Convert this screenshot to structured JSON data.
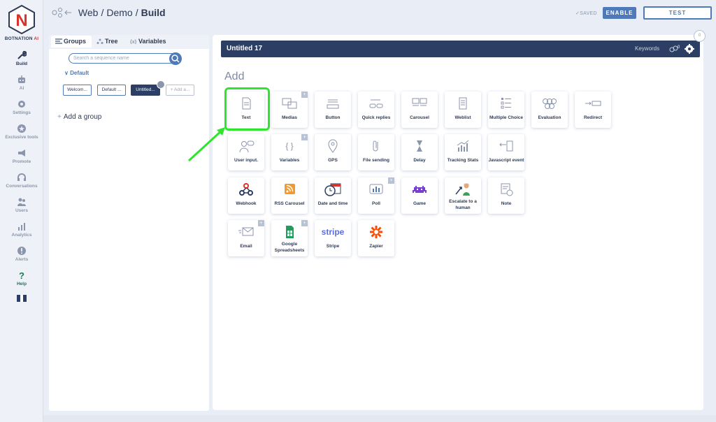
{
  "brand": {
    "name_part1": "BOTNATION",
    "name_part2": " AI"
  },
  "nav": [
    {
      "label": "Build",
      "icon": "wrench-icon",
      "active": true
    },
    {
      "label": "AI",
      "icon": "robot-icon"
    },
    {
      "label": "Settings",
      "icon": "gear-icon"
    },
    {
      "label": "Exclusive tools",
      "icon": "star-icon"
    },
    {
      "label": "Promote",
      "icon": "megaphone-icon"
    },
    {
      "label": "Conversations",
      "icon": "headset-icon"
    },
    {
      "label": "Users",
      "icon": "users-icon"
    },
    {
      "label": "Analytics",
      "icon": "analytics-icon"
    },
    {
      "label": "Alerts",
      "icon": "alert-icon"
    },
    {
      "label": "Help",
      "icon": "question-icon"
    }
  ],
  "header": {
    "crumb1": "Web",
    "crumb2": "Demo",
    "crumb3": "Build",
    "sep": "/",
    "saved": "SAVED",
    "enable": "ENABLE",
    "test": "TEST"
  },
  "left": {
    "tabs": [
      "Groups",
      "Tree",
      "Variables"
    ],
    "search_placeholder": "Search a sequence name",
    "default": "Default",
    "sequences": [
      "Welcom...",
      "Default ...",
      "Untitled...",
      "Add a..."
    ],
    "add_group": "Add a group"
  },
  "main": {
    "sequence_title": "Untitled 17",
    "keywords": "Keywords",
    "keyword_count": "0",
    "counter": "0",
    "add_title": "Add",
    "blocks": [
      {
        "label": "Text"
      },
      {
        "label": "Medias",
        "plus": true
      },
      {
        "label": "Button"
      },
      {
        "label": "Quick replies"
      },
      {
        "label": "Carousel"
      },
      {
        "label": "Weblist"
      },
      {
        "label": "Multiple Choice"
      },
      {
        "label": "Evaluation"
      },
      {
        "label": "Redirect"
      },
      {
        "label": "User input."
      },
      {
        "label": "Variables",
        "plus": true
      },
      {
        "label": "GPS"
      },
      {
        "label": "File sending"
      },
      {
        "label": "Delay"
      },
      {
        "label": "Tracking Stats"
      },
      {
        "label": "Javascript event"
      },
      {
        "label": "Webhook"
      },
      {
        "label": "RSS Carousel"
      },
      {
        "label": "Date and time"
      },
      {
        "label": "Poll",
        "plus": true
      },
      {
        "label": "Game"
      },
      {
        "label": "Escalate to a human"
      },
      {
        "label": "Note"
      },
      {
        "label": "Email",
        "plus": true
      },
      {
        "label": "Google Spreadsheets",
        "plus": true
      },
      {
        "label": "Stripe"
      },
      {
        "label": "Zapier"
      }
    ]
  },
  "colors": {
    "navy": "#2c3e63",
    "accent": "#4f79b8",
    "highlight": "#2ee52e"
  }
}
